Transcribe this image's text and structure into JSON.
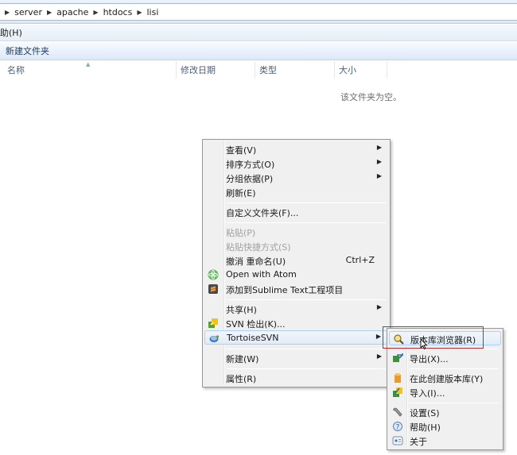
{
  "breadcrumb": [
    "server",
    "apache",
    "htdocs",
    "lisi"
  ],
  "menubar": {
    "help": "助(H)"
  },
  "commandbar": {
    "new_folder": "新建文件夹"
  },
  "columns": [
    "名称",
    "修改日期",
    "类型",
    "大小"
  ],
  "empty_message": "该文件夹为空。",
  "context_menu": {
    "items": [
      {
        "label": "查看(V)",
        "submenu": true
      },
      {
        "label": "排序方式(O)",
        "submenu": true
      },
      {
        "label": "分组依据(P)",
        "submenu": true
      },
      {
        "label": "刷新(E)"
      },
      {
        "label": "自定义文件夹(F)..."
      },
      {
        "label": "粘贴(P)",
        "disabled": true
      },
      {
        "label": "粘贴快捷方式(S)",
        "disabled": true
      },
      {
        "label": "撤消 重命名(U)",
        "shortcut": "Ctrl+Z"
      },
      {
        "label": "Open with Atom",
        "icon": "atom-icon"
      },
      {
        "label": "添加到Sublime Text工程项目",
        "icon": "sublime-icon"
      },
      {
        "label": "共享(H)",
        "submenu": true
      },
      {
        "label": "SVN 检出(K)...",
        "icon": "svn-checkout-icon"
      },
      {
        "label": "TortoiseSVN",
        "submenu": true,
        "icon": "tortoise-icon"
      },
      {
        "label": "新建(W)",
        "submenu": true
      },
      {
        "label": "属性(R)"
      }
    ]
  },
  "tortoise_submenu": {
    "items": [
      {
        "label": "版本库浏览器(R)",
        "icon": "repo-browser-icon"
      },
      {
        "label": "导出(X)...",
        "icon": "export-icon"
      },
      {
        "label": "在此创建版本库(Y)",
        "icon": "create-repo-icon"
      },
      {
        "label": "导入(I)...",
        "icon": "import-icon"
      },
      {
        "label": "设置(S)",
        "icon": "settings-icon"
      },
      {
        "label": "帮助(H)",
        "icon": "help-icon"
      },
      {
        "label": "关于",
        "icon": "about-icon"
      }
    ]
  }
}
